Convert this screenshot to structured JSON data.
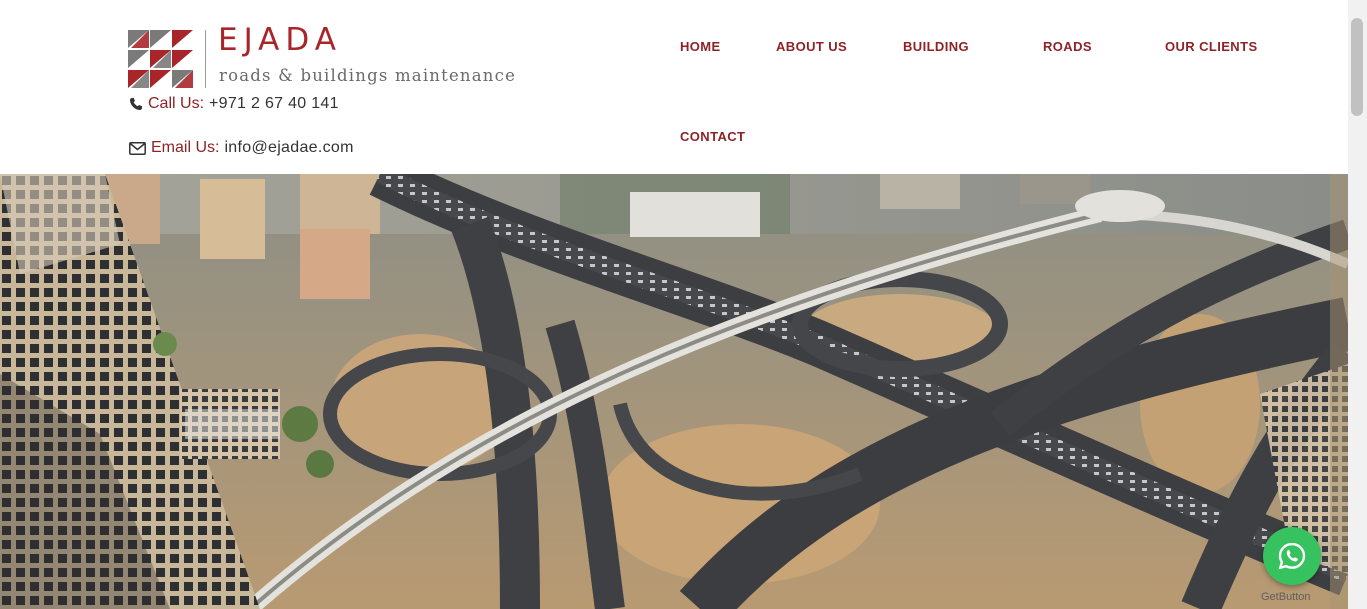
{
  "brand": {
    "name": "EJADA",
    "tagline": "roads & buildings maintenance",
    "color": "#a8262a"
  },
  "contact": {
    "call_label": "Call Us:",
    "call_value": "+971 2 67 40 141",
    "email_label": "Email Us:",
    "email_value": "info@ejadae.com",
    "phone_icon": "phone-icon",
    "email_icon": "envelope-icon"
  },
  "nav": {
    "items": [
      "HOME",
      "ABOUT US",
      "BUILDING",
      "ROADS",
      "OUR CLIENTS",
      "CONTACT"
    ],
    "color": "#8e2327"
  },
  "hero": {
    "subject": "aerial view of highway interchange"
  },
  "whatsapp": {
    "icon": "whatsapp-icon",
    "caption": "GetButton",
    "color": "#36c25e"
  }
}
